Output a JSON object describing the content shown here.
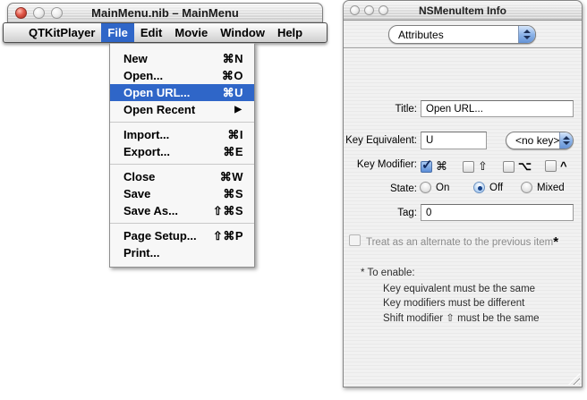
{
  "left_window": {
    "title": "MainMenu.nib – MainMenu",
    "menubar": {
      "items": [
        "QTKitPlayer",
        "File",
        "Edit",
        "Movie",
        "Window",
        "Help"
      ],
      "active_item": "File"
    },
    "menu": {
      "items": [
        {
          "label": "New",
          "shortcut": "⌘N"
        },
        {
          "label": "Open...",
          "shortcut": "⌘O"
        },
        {
          "label": "Open URL...",
          "shortcut": "⌘U",
          "highlighted": true
        },
        {
          "label": "Open Recent",
          "shortcut": "",
          "has_submenu": true
        },
        {
          "label": "Import...",
          "shortcut": "⌘I"
        },
        {
          "label": "Export...",
          "shortcut": "⌘E"
        },
        {
          "label": "Close",
          "shortcut": "⌘W"
        },
        {
          "label": "Save",
          "shortcut": "⌘S"
        },
        {
          "label": "Save As...",
          "shortcut": "⇧⌘S"
        },
        {
          "label": "Page Setup...",
          "shortcut": "⇧⌘P"
        },
        {
          "label": "Print...",
          "shortcut": ""
        }
      ]
    }
  },
  "inspector": {
    "title": "NSMenuItem Info",
    "pane_selector": "Attributes",
    "rows": {
      "title": {
        "label": "Title:",
        "value": "Open URL..."
      },
      "key_equivalent": {
        "label": "Key Equivalent:",
        "value": "U",
        "popup": "<no key>"
      },
      "key_modifier": {
        "label": "Key Modifier:",
        "options": [
          {
            "symbol": "⌘",
            "checked": true
          },
          {
            "symbol": "⇧",
            "checked": false
          },
          {
            "symbol": "⌥",
            "checked": false
          },
          {
            "symbol": "^",
            "checked": false
          }
        ]
      },
      "state": {
        "label": "State:",
        "options": [
          {
            "label": "On",
            "selected": false
          },
          {
            "label": "Off",
            "selected": true
          },
          {
            "label": "Mixed",
            "selected": false
          }
        ]
      },
      "tag": {
        "label": "Tag:",
        "value": "0"
      }
    },
    "alternate": {
      "label": "Treat as an alternate to the previous item",
      "asterisk": "*",
      "checked": false,
      "enabled": false
    },
    "footnote": {
      "header": "* To enable:",
      "lines": [
        "Key equivalent must be the same",
        "Key modifiers must be different",
        "Shift modifier ⇧  must be the same"
      ]
    }
  },
  "icons": {
    "submenu_arrow": "▶"
  },
  "colors": {
    "selection_blue": "#2F66C8",
    "popup_cap_blue": "#8DB4E8",
    "pinstripe_gray": "#ECECEC"
  }
}
